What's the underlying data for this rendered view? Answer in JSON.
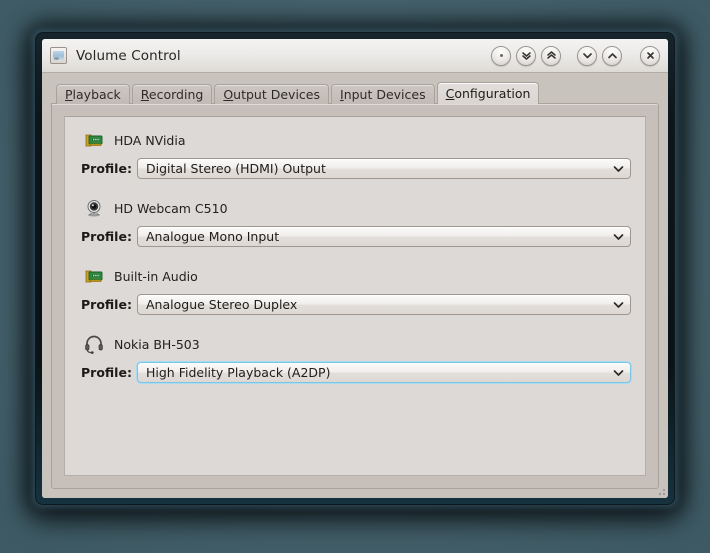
{
  "window": {
    "title": "Volume Control",
    "icon": "app-icon",
    "titlebar_buttons": [
      {
        "name": "menu-button",
        "glyph": "dot"
      },
      {
        "name": "shade-down-button",
        "glyph": "double-chevron-down"
      },
      {
        "name": "shade-up-button",
        "glyph": "double-chevron-up"
      },
      {
        "name": "minimize-button",
        "glyph": "chevron-down"
      },
      {
        "name": "maximize-button",
        "glyph": "chevron-up"
      },
      {
        "name": "close-button",
        "glyph": "close-x"
      }
    ]
  },
  "tabs": [
    {
      "label": "Playback",
      "mnemonic": "P",
      "active": false
    },
    {
      "label": "Recording",
      "mnemonic": "R",
      "active": false
    },
    {
      "label": "Output Devices",
      "mnemonic": "O",
      "active": false
    },
    {
      "label": "Input Devices",
      "mnemonic": "I",
      "active": false
    },
    {
      "label": "Configuration",
      "mnemonic": "C",
      "active": true
    }
  ],
  "profile_label": "Profile:",
  "devices": [
    {
      "name": "HDA NVidia",
      "icon": "sound-card-icon",
      "profile": "Digital Stereo (HDMI) Output",
      "focused": false
    },
    {
      "name": "HD Webcam C510",
      "icon": "webcam-icon",
      "profile": "Analogue Mono Input",
      "focused": false
    },
    {
      "name": "Built-in Audio",
      "icon": "sound-card-icon",
      "profile": "Analogue Stereo Duplex",
      "focused": false
    },
    {
      "name": "Nokia BH-503",
      "icon": "headset-icon",
      "profile": "High Fidelity Playback (A2DP)",
      "focused": true
    }
  ],
  "colors": {
    "desktop": "#4b666f",
    "window_frame": "#0b1419",
    "titlebar": "#ecebe9",
    "tab_pane": "#c6bfba",
    "scroll_area": "#ddd9d6",
    "focus_blue": "#7ec4e4"
  }
}
